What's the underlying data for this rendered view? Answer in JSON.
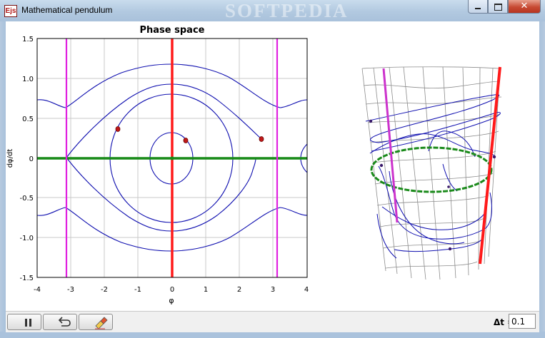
{
  "window": {
    "title": "Mathematical pendulum",
    "icon": "Ejs",
    "watermark": "SOFTPEDIA"
  },
  "plot": {
    "title": "Phase space",
    "xlabel": "φ",
    "ylabel": "dφ/dt",
    "x_ticks": [
      "-4",
      "-3",
      "-2",
      "-1",
      "0",
      "1",
      "2",
      "3",
      "4"
    ],
    "y_ticks": [
      "1.5",
      "1.0",
      "0.5",
      "0",
      "-0.5",
      "-1.0",
      "-1.5"
    ]
  },
  "toolbar": {
    "pause_icon": "pause-icon",
    "reset_icon": "reset-icon",
    "clear_icon": "eraser-icon",
    "dt_label": "Δt =",
    "dt_value": "0.1"
  },
  "colors": {
    "trajectory": "#1010b0",
    "x_axis": "#178a17",
    "y_axis": "#ff1a1a",
    "separatrix": "#e020e0",
    "point": "#c01818"
  }
}
